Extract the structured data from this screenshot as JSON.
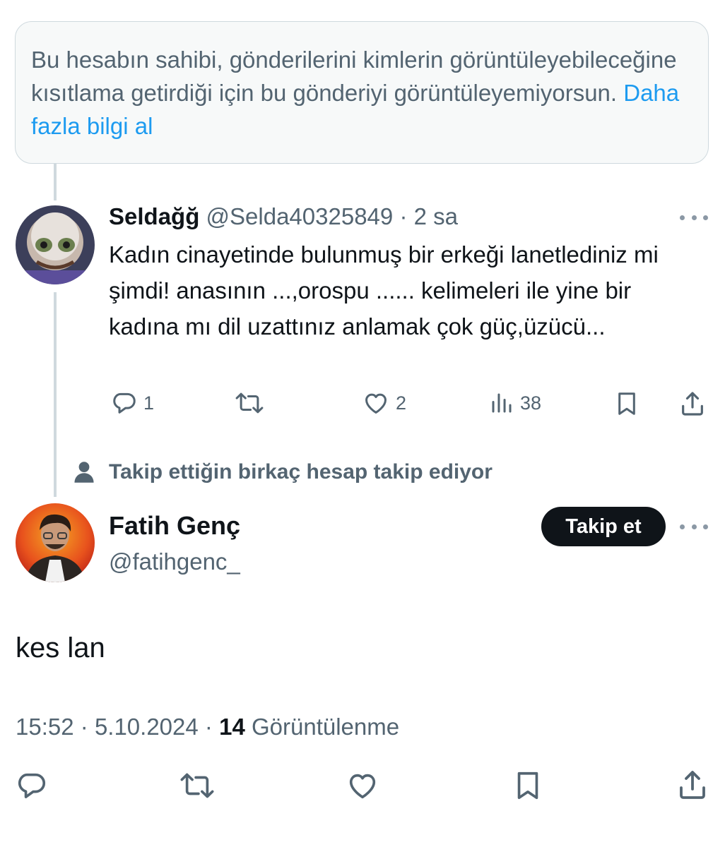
{
  "notice": {
    "text": "Bu hesabın sahibi, gönderilerini kimlerin görüntüleyebileceğine kısıtlama getirdiği için bu gönderiyi görüntüleyemiyorsun.",
    "link": "Daha fazla bilgi al"
  },
  "reply": {
    "name": "Seldağğ",
    "handle": "@Selda40325849",
    "separator": "·",
    "time": "2 sa",
    "text": "Kadın cinayetinde bulunmuş bir erkeği lanetlediniz mi şimdi! anasının ...,orospu ...... kelimeleri ile yine bir kadına mı dil uzattınız anlamak çok güç,üzücü...",
    "actions": {
      "replies": "1",
      "reposts": "",
      "likes": "2",
      "views": "38"
    }
  },
  "social_context": "Takip ettiğin birkaç hesap takip ediyor",
  "main": {
    "name": "Fatih Genç",
    "handle": "@fatihgenc_",
    "follow_label": "Takip et",
    "text": "kes lan",
    "time": "15:52",
    "date": "5.10.2024",
    "separator": "·",
    "views_count": "14",
    "views_label": "Görüntülenme"
  },
  "colors": {
    "accent": "#1d9bf0",
    "text_primary": "#0f1419",
    "text_secondary": "#536471",
    "border": "#cfd9de"
  },
  "icons": {
    "reply": "speech-bubble-icon",
    "repost": "repost-arrows-icon",
    "like": "heart-icon",
    "views": "bar-chart-icon",
    "bookmark": "bookmark-icon",
    "share": "share-upload-icon",
    "more": "more-dots-icon",
    "person": "person-icon"
  }
}
